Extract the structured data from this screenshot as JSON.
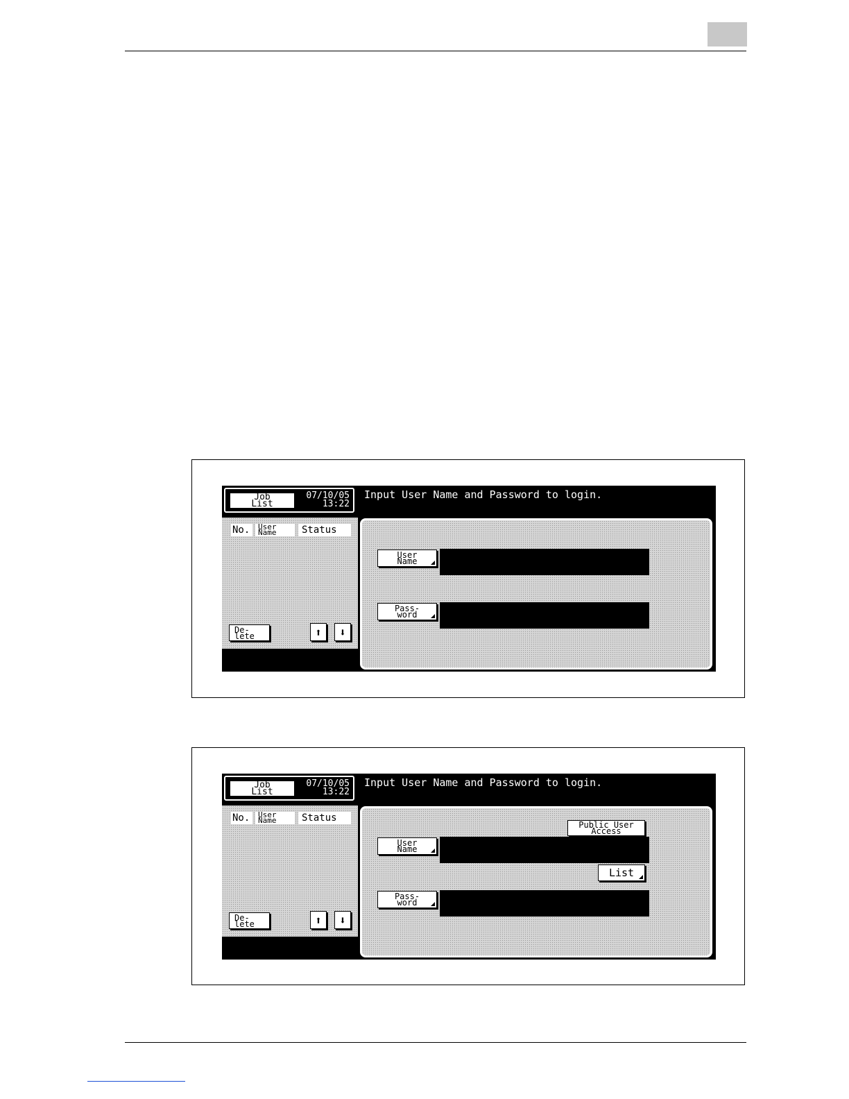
{
  "page": {},
  "screens": [
    {
      "job_list_label": "Job\nList",
      "date": "07/10/05",
      "time": "13:22",
      "message": "Input User Name and Password to login.",
      "columns": {
        "no": "No.",
        "user_name": "User\nName",
        "status": "Status"
      },
      "delete_label": "De-\nlete",
      "up_icon": "up-arrow-icon",
      "down_icon": "down-arrow-icon",
      "user_name_label": "User\nName",
      "password_label": "Pass-\nword",
      "user_name_value": "",
      "password_value": ""
    },
    {
      "job_list_label": "Job\nList",
      "date": "07/10/05",
      "time": "13:22",
      "message": "Input User Name and Password to login.",
      "columns": {
        "no": "No.",
        "user_name": "User\nName",
        "status": "Status"
      },
      "delete_label": "De-\nlete",
      "up_icon": "up-arrow-icon",
      "down_icon": "down-arrow-icon",
      "public_user_label": "Public User\nAccess",
      "user_name_label": "User\nName",
      "list_label": "List",
      "password_label": "Pass-\nword",
      "user_name_value": "",
      "password_value": ""
    }
  ]
}
